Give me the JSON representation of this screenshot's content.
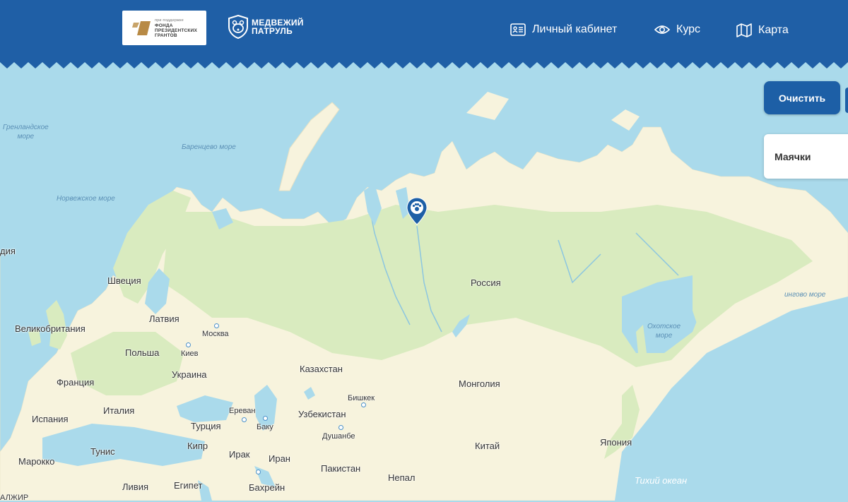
{
  "header": {
    "grant_logo": {
      "line1": "при поддержке",
      "line2": "ФОНДА",
      "line3": "ПРЕЗИДЕНТСКИХ",
      "line4": "ГРАНТОВ"
    },
    "brand": {
      "line1": "МЕДВЕЖИЙ",
      "line2": "ПАТРУЛЬ"
    },
    "nav": [
      {
        "label": "Личный кабинет",
        "icon": "id-card-icon"
      },
      {
        "label": "Курс",
        "icon": "eye-icon"
      },
      {
        "label": "Карта",
        "icon": "map-icon"
      }
    ]
  },
  "controls": {
    "clear_label": "Очистить",
    "panel_label": "Маячки"
  },
  "map": {
    "countries": {
      "russia": "Россия",
      "sweden": "Швеция",
      "latvia": "Латвия",
      "uk": "Великобритания",
      "poland": "Польша",
      "ukraine": "Украина",
      "france": "Франция",
      "italy": "Италия",
      "spain": "Испания",
      "turkey": "Турция",
      "cyprus": "Кипр",
      "tunisia": "Тунис",
      "morocco": "Марокко",
      "libya": "Ливия",
      "egypt": "Египет",
      "iraq": "Ирак",
      "iran": "Иран",
      "kazakhstan": "Казахстан",
      "uzbekistan": "Узбекистан",
      "pakistan": "Пакистан",
      "nepal": "Непал",
      "mongolia": "Монголия",
      "china": "Китай",
      "japan": "Япония",
      "bahrain": "Бахрейн",
      "iceland_partial": "дия",
      "algeria_partial": "АЛЖИР"
    },
    "cities": {
      "moscow": "Москва",
      "kyiv": "Киев",
      "yerevan": "Ереван",
      "baku": "Баку",
      "bishkek": "Бишкек",
      "dushanbe": "Душанбе"
    },
    "seas": {
      "greenland": "Гренландское\nморе",
      "barents": "Баренцево море",
      "norwegian": "Норвежское море",
      "okhotsk": "Охотское\nморе",
      "bering": "ингово море",
      "pacific": "Тихий океан"
    },
    "colors": {
      "water": "#aadaeb",
      "land": "#f7f3dd",
      "forest": "#d9ebbf",
      "header": "#1f5fa6"
    }
  }
}
